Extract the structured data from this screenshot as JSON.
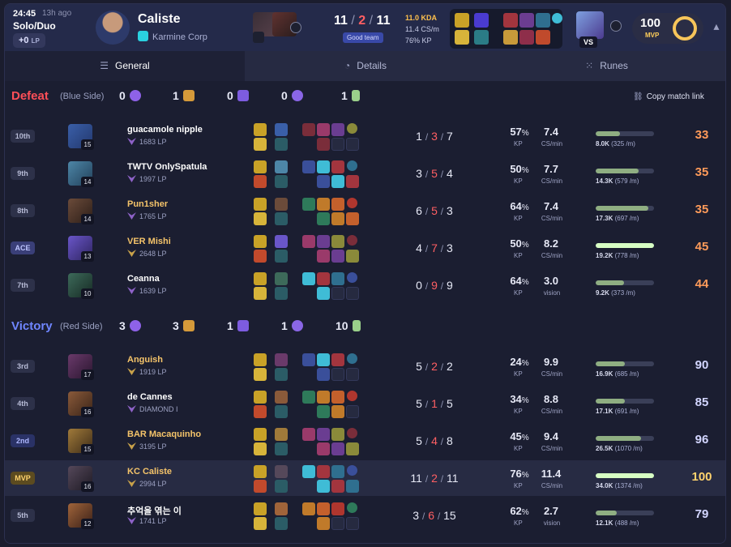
{
  "header": {
    "time": "24:45",
    "ago": "13h ago",
    "queue": "Solo/Duo",
    "lp_change": "+0",
    "lp_unit": "LP",
    "player_name": "Caliste",
    "team_name": "Karmine Corp",
    "kda_k": "11",
    "kda_d": "2",
    "kda_a": "11",
    "kda_sep": "/",
    "tag": "Good team",
    "kda_ratio": "11.0 KDA",
    "cs_per_min": "11.4 CS/m",
    "kp": "76% KP",
    "vs_label": "VS",
    "mvp_score": "100",
    "mvp_label": "MVP"
  },
  "tabs": [
    {
      "label": "General",
      "icon": "list-icon"
    },
    {
      "label": "Details",
      "icon": "pie-icon"
    },
    {
      "label": "Runes",
      "icon": "grid-icon"
    }
  ],
  "defeat": {
    "result": "Defeat",
    "side": "(Blue Side)",
    "objectives": [
      "0",
      "1",
      "0",
      "0",
      "1"
    ],
    "copy_link": "Copy match link",
    "players": [
      {
        "rank": "10th",
        "level": "15",
        "name": "guacamole nipple",
        "lp": "1683 LP",
        "k": "1",
        "d": "3",
        "a": "7",
        "kp": "57",
        "kp_unit": "%",
        "kp_label": "KP",
        "cs": "7.4",
        "cs_label": "CS/min",
        "dmg": "8.0K",
        "dmg_rate": "(325 /m)",
        "dmg_frac": 0.41,
        "score": "33"
      },
      {
        "rank": "9th",
        "level": "14",
        "name": "TWTV OnlySpatula",
        "lp": "1997 LP",
        "k": "3",
        "d": "5",
        "a": "4",
        "kp": "50",
        "kp_unit": "%",
        "kp_label": "KP",
        "cs": "7.7",
        "cs_label": "CS/min",
        "dmg": "14.3K",
        "dmg_rate": "(579 /m)",
        "dmg_frac": 0.74,
        "score": "35"
      },
      {
        "rank": "8th",
        "level": "14",
        "name": "Pun1sher",
        "lp": "1765 LP",
        "k": "6",
        "d": "5",
        "a": "3",
        "kp": "64",
        "kp_unit": "%",
        "kp_label": "KP",
        "cs": "7.4",
        "cs_label": "CS/min",
        "dmg": "17.3K",
        "dmg_rate": "(697 /m)",
        "dmg_frac": 0.9,
        "score": "35"
      },
      {
        "rank": "ACE",
        "level": "13",
        "name": "VER Mishi",
        "lp": "2648 LP",
        "k": "4",
        "d": "7",
        "a": "3",
        "kp": "50",
        "kp_unit": "%",
        "kp_label": "KP",
        "cs": "8.2",
        "cs_label": "CS/min",
        "dmg": "19.2K",
        "dmg_rate": "(778 /m)",
        "dmg_frac": 1.0,
        "score": "45"
      },
      {
        "rank": "7th",
        "level": "10",
        "name": "Ceanna",
        "lp": "1639 LP",
        "k": "0",
        "d": "9",
        "a": "9",
        "kp": "64",
        "kp_unit": "%",
        "kp_label": "KP",
        "cs": "3.0",
        "cs_label": "vision",
        "dmg": "9.2K",
        "dmg_rate": "(373 /m)",
        "dmg_frac": 0.48,
        "score": "44"
      }
    ]
  },
  "victory": {
    "result": "Victory",
    "side": "(Red Side)",
    "objectives": [
      "3",
      "3",
      "1",
      "1",
      "10"
    ],
    "players": [
      {
        "rank": "3rd",
        "level": "17",
        "name": "Anguish",
        "lp": "1919 LP",
        "k": "5",
        "d": "2",
        "a": "2",
        "kp": "24",
        "kp_unit": "%",
        "kp_label": "KP",
        "cs": "9.9",
        "cs_label": "CS/min",
        "dmg": "16.9K",
        "dmg_rate": "(685 /m)",
        "dmg_frac": 0.5,
        "score": "90"
      },
      {
        "rank": "4th",
        "level": "16",
        "name": "de Cannes",
        "lp": "DIAMOND I",
        "k": "5",
        "d": "1",
        "a": "5",
        "kp": "34",
        "kp_unit": "%",
        "kp_label": "KP",
        "cs": "8.8",
        "cs_label": "CS/min",
        "dmg": "17.1K",
        "dmg_rate": "(691 /m)",
        "dmg_frac": 0.5,
        "score": "85"
      },
      {
        "rank": "2nd",
        "level": "15",
        "name": "BAR Macaquinho",
        "lp": "3195 LP",
        "k": "5",
        "d": "4",
        "a": "8",
        "kp": "45",
        "kp_unit": "%",
        "kp_label": "KP",
        "cs": "9.4",
        "cs_label": "CS/min",
        "dmg": "26.5K",
        "dmg_rate": "(1070 /m)",
        "dmg_frac": 0.78,
        "score": "96"
      },
      {
        "rank": "MVP",
        "level": "16",
        "name": "KC Caliste",
        "lp": "2994 LP",
        "k": "11",
        "d": "2",
        "a": "11",
        "kp": "76",
        "kp_unit": "%",
        "kp_label": "KP",
        "cs": "11.4",
        "cs_label": "CS/min",
        "dmg": "34.0K",
        "dmg_rate": "(1374 /m)",
        "dmg_frac": 1.0,
        "score": "100"
      },
      {
        "rank": "5th",
        "level": "12",
        "name": "추억을 엮는 이",
        "lp": "1741 LP",
        "k": "3",
        "d": "6",
        "a": "15",
        "kp": "62",
        "kp_unit": "%",
        "kp_label": "KP",
        "cs": "2.7",
        "cs_label": "vision",
        "dmg": "12.1K",
        "dmg_rate": "(488 /m)",
        "dmg_frac": 0.36,
        "score": "79"
      }
    ]
  },
  "colors": {
    "defeat": "#ff4f58",
    "victory": "#6f86ff",
    "mvp_gold": "#ffd36e",
    "death_red": "#ff5f63",
    "damage_bar": "#8fae82",
    "damage_bar_top": "#d7ffc4"
  }
}
